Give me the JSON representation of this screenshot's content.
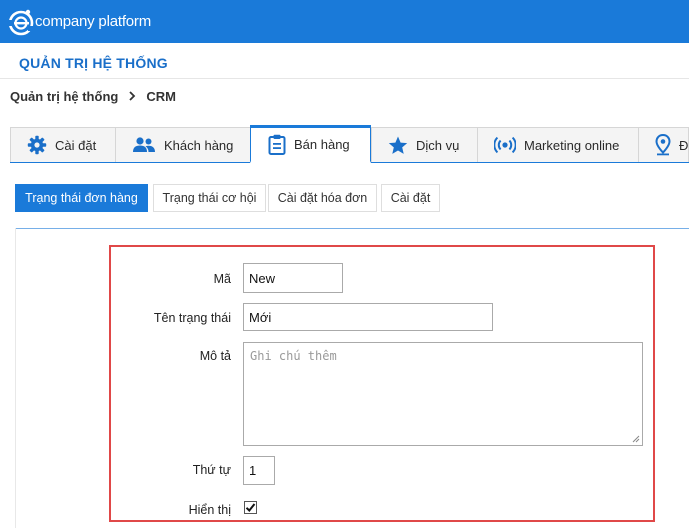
{
  "app": {
    "logo_letter": "e",
    "logo_text": "company platform"
  },
  "header": {
    "title": "QUẢN TRỊ HỆ THỐNG"
  },
  "breadcrumb": {
    "items": [
      "Quản trị hệ thống",
      "CRM"
    ],
    "separator": ">"
  },
  "tabs": [
    {
      "label": "Cài đặt",
      "icon": "gear-icon",
      "active": false
    },
    {
      "label": "Khách hàng",
      "icon": "people-icon",
      "active": false
    },
    {
      "label": "Bán hàng",
      "icon": "clipboard-icon",
      "active": true
    },
    {
      "label": "Dịch vụ",
      "icon": "star-icon",
      "active": false
    },
    {
      "label": "Marketing online",
      "icon": "broadcast-icon",
      "active": false
    },
    {
      "label": "Đ",
      "icon": "map-pin-icon",
      "active": false
    }
  ],
  "subtabs": [
    {
      "label": "Trạng thái đơn hàng",
      "active": true
    },
    {
      "label": "Trạng thái cơ hội",
      "active": false
    },
    {
      "label": "Cài đặt hóa đơn",
      "active": false
    },
    {
      "label": "Cài đặt",
      "active": false
    }
  ],
  "form": {
    "code": {
      "label": "Mã",
      "value": "New"
    },
    "status_name": {
      "label": "Tên trạng thái",
      "value": "Mới"
    },
    "description": {
      "label": "Mô tả",
      "placeholder": "Ghi chú thêm",
      "value": ""
    },
    "order": {
      "label": "Thứ tự",
      "value": "1"
    },
    "visible": {
      "label": "Hiển thị",
      "checked": true
    }
  },
  "colors": {
    "brand": "#1a7ad9",
    "title": "#1a6fc9",
    "highlight_border": "#e04848"
  }
}
